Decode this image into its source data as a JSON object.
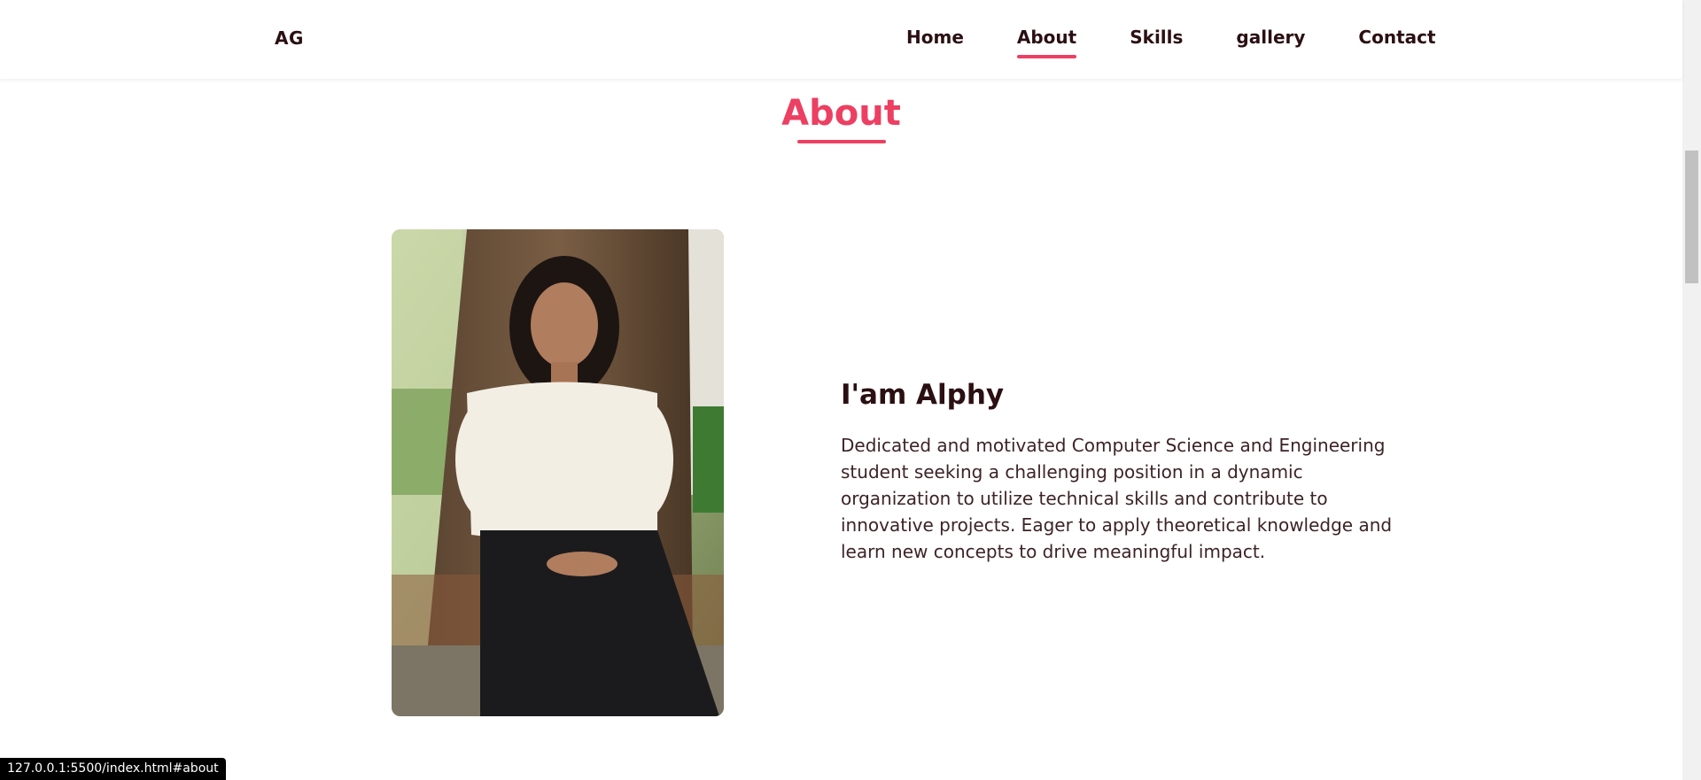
{
  "header": {
    "logo": "AG",
    "nav": [
      {
        "label": "Home",
        "active": false
      },
      {
        "label": "About",
        "active": true
      },
      {
        "label": "Skills",
        "active": false
      },
      {
        "label": "gallery",
        "active": false
      },
      {
        "label": "Contact",
        "active": false
      }
    ]
  },
  "about": {
    "title": "About",
    "greeting": "I'am Alphy",
    "bio": "Dedicated and motivated Computer Science and Engineering student seeking a challenging position in a dynamic organization to utilize technical skills and contribute to innovative projects. Eager to apply theoretical knowledge and learn new concepts to drive meaningful impact."
  },
  "status_bar": {
    "url": "127.0.0.1:5500/index.html#about"
  },
  "colors": {
    "accent": "#ec3f62",
    "text_dark": "#2b0f12"
  }
}
